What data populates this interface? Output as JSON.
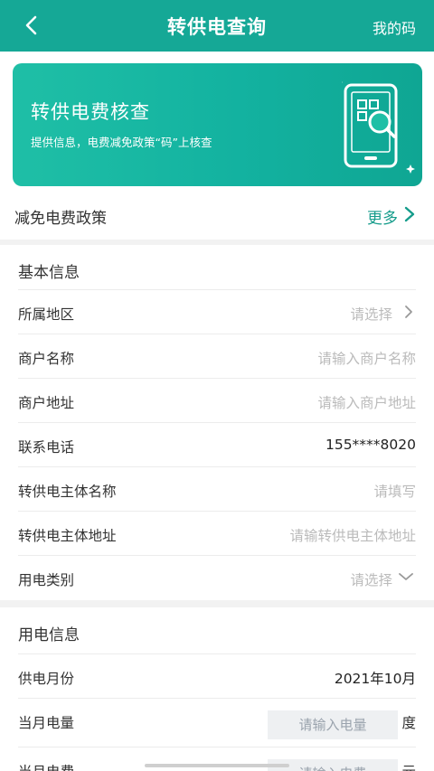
{
  "header": {
    "title": "转供电查询",
    "right_link": "我的码"
  },
  "banner": {
    "title": "转供电费核查",
    "subtitle": "提供信息，电费减免政策“码”上核查"
  },
  "policy": {
    "label": "减免电费政策",
    "more": "更多"
  },
  "basic_info": {
    "title": "基本信息",
    "region": {
      "label": "所属地区",
      "placeholder": "请选择"
    },
    "merchant_name": {
      "label": "商户名称",
      "placeholder": "请输入商户名称"
    },
    "merchant_address": {
      "label": "商户地址",
      "placeholder": "请输入商户地址"
    },
    "phone": {
      "label": "联系电话",
      "value": "155****8020"
    },
    "supplier_name": {
      "label": "转供电主体名称",
      "placeholder": "请填写"
    },
    "supplier_address": {
      "label": "转供电主体地址",
      "placeholder": "请输转供电主体地址"
    },
    "usage_type": {
      "label": "用电类别",
      "placeholder": "请选择"
    }
  },
  "usage_info": {
    "title": "用电信息",
    "month": {
      "label": "供电月份",
      "value": "2021年10月"
    },
    "kwh": {
      "label": "当月电量",
      "placeholder": "请输入电量",
      "unit": "度"
    },
    "fee": {
      "label": "当月电费",
      "placeholder": "请输入电费",
      "unit": "元"
    }
  },
  "colors": {
    "primary": "#15a896",
    "link": "#159c8b"
  }
}
